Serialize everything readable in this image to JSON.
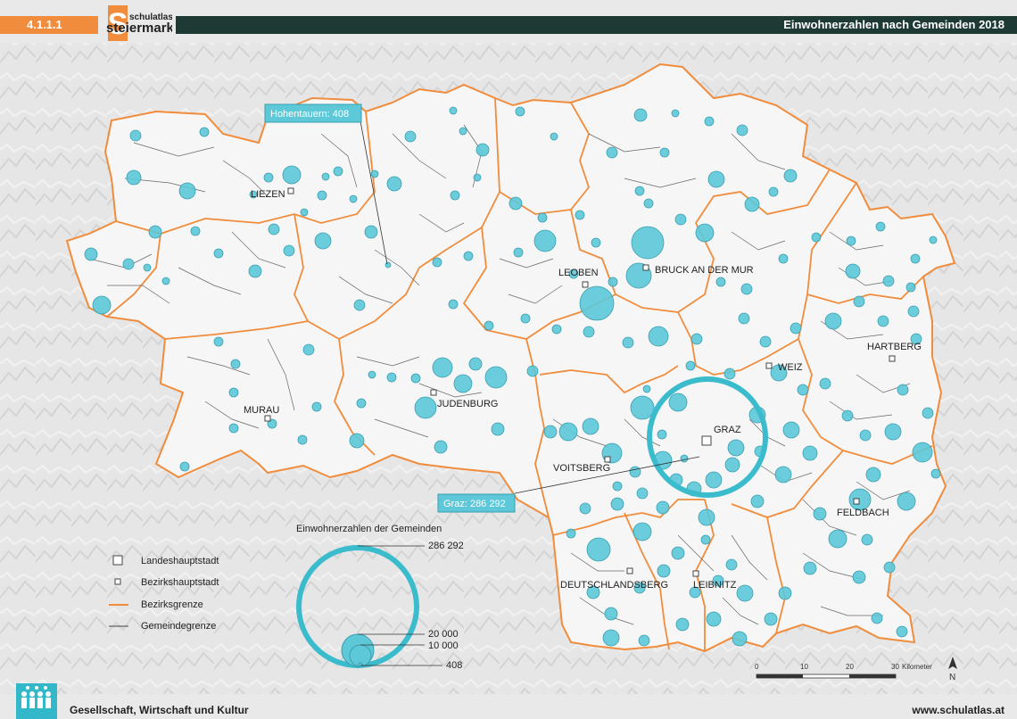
{
  "header": {
    "code": "4.1.1.1",
    "logo_text_top": "schulatlas",
    "logo_text_bottom": "steiermark",
    "title": "Einwohnerzahlen nach Gemeinden 2018"
  },
  "map": {
    "callouts": [
      {
        "label": "Hohentauern: 408"
      },
      {
        "label": "Graz: 286 292"
      }
    ],
    "towns": [
      {
        "name": "LIEZEN",
        "type": "bezirkshauptstadt"
      },
      {
        "name": "LEOBEN",
        "type": "bezirkshauptstadt"
      },
      {
        "name": "BRUCK AN DER MUR",
        "type": "bezirkshauptstadt"
      },
      {
        "name": "HARTBERG",
        "type": "bezirkshauptstadt"
      },
      {
        "name": "WEIZ",
        "type": "bezirkshauptstadt"
      },
      {
        "name": "MURAU",
        "type": "bezirkshauptstadt"
      },
      {
        "name": "JUDENBURG",
        "type": "bezirkshauptstadt"
      },
      {
        "name": "GRAZ",
        "type": "landeshauptstadt"
      },
      {
        "name": "VOITSBERG",
        "type": "bezirkshauptstadt"
      },
      {
        "name": "FELDBACH",
        "type": "bezirkshauptstadt"
      },
      {
        "name": "DEUTSCHLANDSBERG",
        "type": "bezirkshauptstadt"
      },
      {
        "name": "LEIBNITZ",
        "type": "bezirkshauptstadt"
      }
    ],
    "colors": {
      "bezirksgrenze": "#f08c3c",
      "gemeindegrenze": "#555555",
      "circle_fill": "#5cc8d8",
      "circle_stroke": "#3a9fb0",
      "graz_ring": "#3bbccd",
      "state_fill": "#f7f7f7"
    }
  },
  "legend": {
    "title": "Einwohnerzahlen der Gemeinden",
    "values": [
      "286 292",
      "20 000",
      "10 000",
      "408"
    ],
    "items": [
      {
        "label": "Landeshauptstadt",
        "symbol": "large-square"
      },
      {
        "label": "Bezirkshauptstadt",
        "symbol": "small-square"
      },
      {
        "label": "Bezirksgrenze",
        "symbol": "orange-line"
      },
      {
        "label": "Gemeindegrenze",
        "symbol": "dark-line"
      }
    ]
  },
  "scale": {
    "ticks": [
      "0",
      "10",
      "20",
      "30"
    ],
    "unit": "Kilometer",
    "north": "N"
  },
  "footer": {
    "left": "Gesellschaft, Wirtschaft und Kultur",
    "right": "www.schulatlas.at"
  }
}
